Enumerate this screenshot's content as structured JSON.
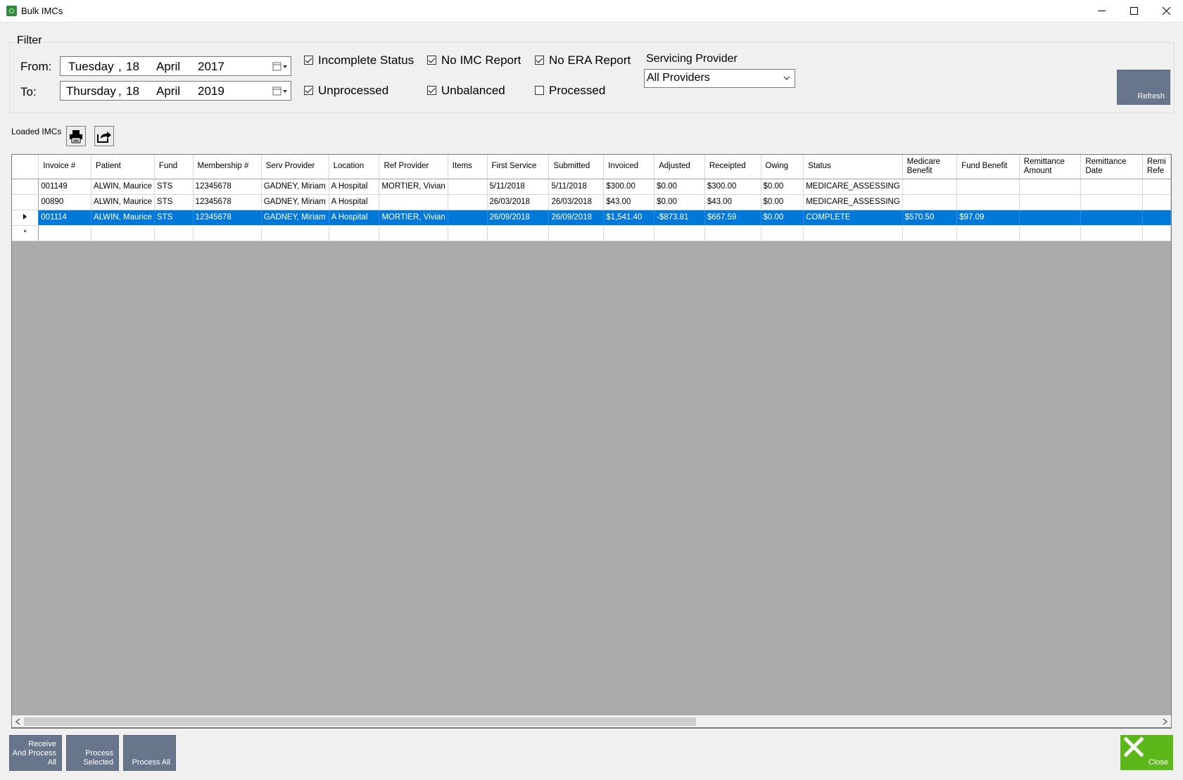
{
  "window": {
    "title": "Bulk IMCs"
  },
  "filter": {
    "legend": "Filter",
    "from_label": "From:",
    "to_label": "To:",
    "from_date": {
      "day": "Tuesday",
      "comma": ",",
      "date": "18",
      "month": "April",
      "year": "2017"
    },
    "to_date": {
      "day": "Thursday",
      "comma": ",",
      "date": "18",
      "month": "April",
      "year": "2019"
    },
    "checkboxes": {
      "incomplete_status": {
        "label": "Incomplete Status",
        "checked": true
      },
      "no_imc_report": {
        "label": "No IMC Report",
        "checked": true
      },
      "no_era_report": {
        "label": "No ERA Report",
        "checked": true
      },
      "unprocessed": {
        "label": "Unprocessed",
        "checked": true
      },
      "unbalanced": {
        "label": "Unbalanced",
        "checked": true
      },
      "processed": {
        "label": "Processed",
        "checked": false
      }
    },
    "servicing_provider_label": "Servicing Provider",
    "servicing_provider_value": "All Providers",
    "refresh_label": "Refresh"
  },
  "toolbar": {
    "label": "Loaded IMCs",
    "print_icon": "printer-icon",
    "export_icon": "export-icon"
  },
  "grid": {
    "columns": [
      "Invoice #",
      "Patient",
      "Fund",
      "Membership #",
      "Serv Provider",
      "Location",
      "Ref Provider",
      "Items",
      "First Service",
      "Submitted",
      "Invoiced",
      "Adjusted",
      "Receipted",
      "Owing",
      "Status",
      "Medicare Benefit",
      "Fund Benefit",
      "Remittance Amount",
      "Remittance Date",
      "Remi Refe"
    ],
    "rows": [
      [
        "001149",
        "ALWIN, Maurice",
        "STS",
        "12345678",
        "GADNEY, Miriam",
        "A Hospital",
        "MORTIER, Vivian",
        "",
        "5/11/2018",
        "5/11/2018",
        "$300.00",
        "$0.00",
        "$300.00",
        "$0.00",
        "MEDICARE_ASSESSING",
        "",
        "",
        "",
        "",
        ""
      ],
      [
        "00890",
        "ALWIN, Maurice",
        "STS",
        "12345678",
        "GADNEY, Miriam",
        "A Hospital",
        "",
        "",
        "26/03/2018",
        "26/03/2018",
        "$43.00",
        "$0.00",
        "$43.00",
        "$0.00",
        "MEDICARE_ASSESSING",
        "",
        "",
        "",
        "",
        ""
      ],
      [
        "001114",
        "ALWIN, Maurice",
        "STS",
        "12345678",
        "GADNEY, Miriam",
        "A Hospital",
        "MORTIER, Vivian",
        "",
        "26/09/2018",
        "26/09/2018",
        "$1,541.40",
        "-$873.81",
        "$667.59",
        "$0.00",
        "COMPLETE",
        "$570.50",
        "$97.09",
        "",
        "",
        ""
      ]
    ],
    "selected_row": 2,
    "new_row_marker": "*"
  },
  "actions": {
    "receive_and_process_all": "Receive\nAnd Process\nAll",
    "process_selected": "Process\nSelected",
    "process_all": "Process All",
    "close": "Close"
  },
  "colors": {
    "action_button": "#67768a",
    "close_button": "#5bb71a",
    "selection": "#0078d7"
  }
}
